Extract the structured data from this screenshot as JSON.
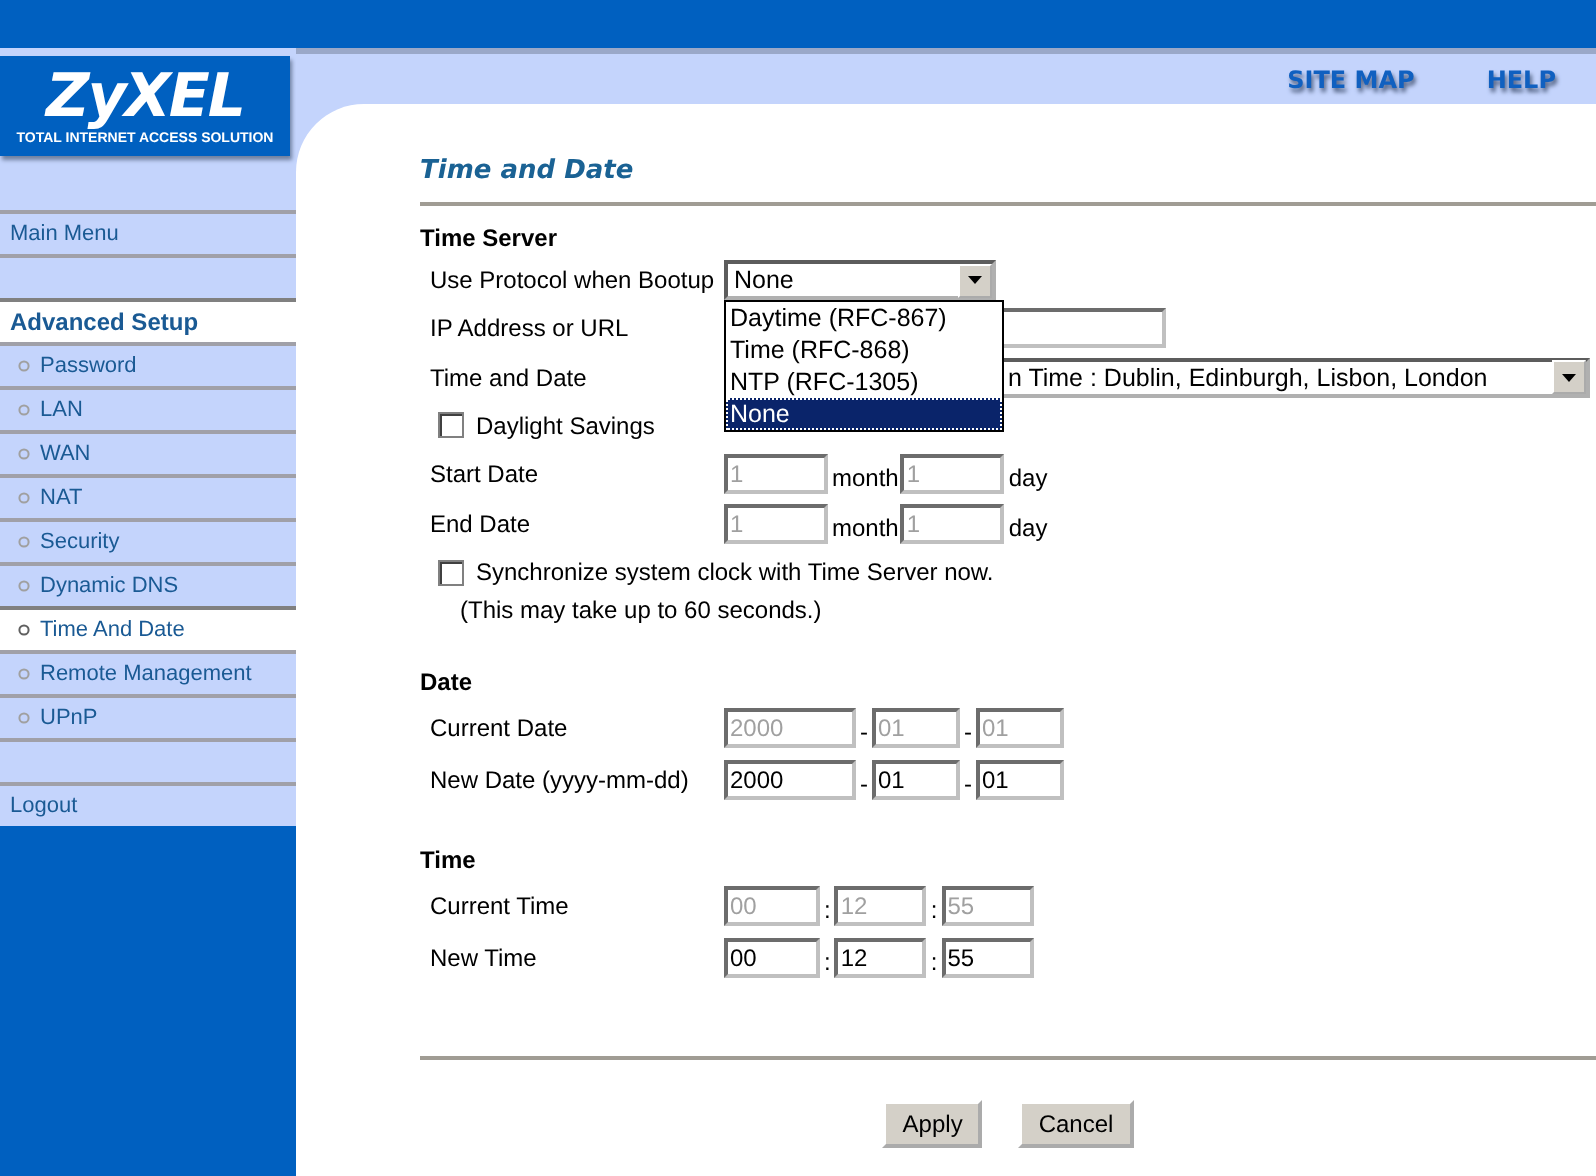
{
  "header": {
    "links": [
      {
        "label": "SITE MAP"
      },
      {
        "label": "HELP"
      }
    ]
  },
  "logo": {
    "name": "ZyXEL",
    "tagline": "TOTAL INTERNET ACCESS SOLUTION"
  },
  "sidebar": {
    "main_menu": {
      "label": "Main Menu"
    },
    "section": {
      "title": "Advanced Setup",
      "items": [
        {
          "label": "Password",
          "selected": false
        },
        {
          "label": "LAN",
          "selected": false
        },
        {
          "label": "WAN",
          "selected": false
        },
        {
          "label": "NAT",
          "selected": false
        },
        {
          "label": "Security",
          "selected": false
        },
        {
          "label": "Dynamic DNS",
          "selected": false
        },
        {
          "label": "Time And Date",
          "selected": true
        },
        {
          "label": "Remote Management",
          "selected": false
        },
        {
          "label": "UPnP",
          "selected": false
        }
      ]
    },
    "logout": {
      "label": "Logout"
    }
  },
  "page_title": "Time and Date",
  "time_server": {
    "title": "Time Server",
    "protocol": {
      "label": "Use Protocol when Bootup",
      "value": "None",
      "expanded": true,
      "options": [
        {
          "label": "Daytime (RFC-867)",
          "selected": false
        },
        {
          "label": "Time (RFC-868)",
          "selected": false
        },
        {
          "label": "NTP (RFC-1305)",
          "selected": false
        },
        {
          "label": "None",
          "selected": true
        }
      ]
    },
    "ip": {
      "label": "IP Address or URL"
    },
    "timezone": {
      "label": "Time and Date",
      "value": "n Time : Dublin, Edinburgh, Lisbon, London"
    },
    "daylight": {
      "label": "Daylight Savings",
      "checked": false
    },
    "ranges": [
      {
        "label": "Start Date",
        "month": "1",
        "month_unit": "month",
        "day": "1",
        "day_unit": "day",
        "disabled": true
      },
      {
        "label": "End Date",
        "month": "1",
        "month_unit": "month",
        "day": "1",
        "day_unit": "day",
        "disabled": true
      }
    ],
    "sync": {
      "label": "Synchronize system clock with Time Server now.",
      "checked": false,
      "note": "(This may take up to 60 seconds.)"
    }
  },
  "sections": [
    {
      "title": "Date",
      "kind": "date",
      "rows": [
        {
          "label": "Current Date",
          "disabled": true,
          "fields": [
            {
              "value": "2000"
            },
            {
              "separator": "-",
              "value": "01"
            },
            {
              "separator": "-",
              "value": "01"
            }
          ]
        },
        {
          "label": "New Date (yyyy-mm-dd)",
          "disabled": false,
          "fields": [
            {
              "value": "2000"
            },
            {
              "separator": "-",
              "value": "01"
            },
            {
              "separator": "-",
              "value": "01"
            }
          ]
        }
      ]
    },
    {
      "title": "Time",
      "kind": "time",
      "rows": [
        {
          "label": "Current Time",
          "disabled": true,
          "fields": [
            {
              "value": "00"
            },
            {
              "separator": ":",
              "value": "12"
            },
            {
              "separator": ":",
              "value": "55"
            }
          ]
        },
        {
          "label": "New Time",
          "disabled": false,
          "fields": [
            {
              "value": "00"
            },
            {
              "separator": ":",
              "value": "12"
            },
            {
              "separator": ":",
              "value": "55"
            }
          ]
        }
      ]
    }
  ],
  "buttons": [
    {
      "label": "Apply"
    },
    {
      "label": "Cancel"
    }
  ]
}
